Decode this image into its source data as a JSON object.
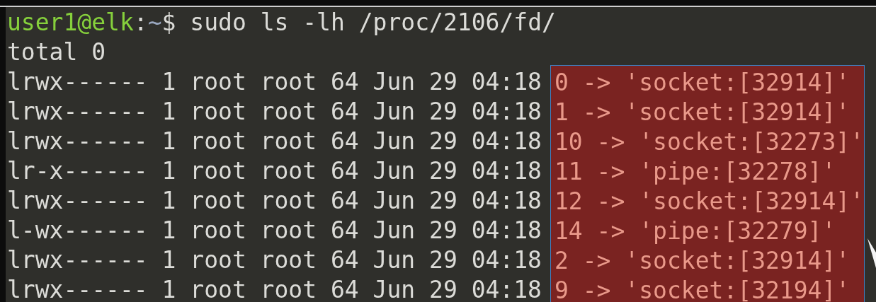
{
  "prompt": {
    "user_host": "user1@elk",
    "separator": ":",
    "path": "~",
    "symbol": "$",
    "command": "sudo ls -lh /proc/2106/fd/"
  },
  "output_lines": [
    "total 0"
  ],
  "entries": [
    {
      "listing": "lrwx------ 1 root root 64 Jun 29 04:18",
      "target": "0 -> 'socket:[32914]'"
    },
    {
      "listing": "lrwx------ 1 root root 64 Jun 29 04:18",
      "target": "1 -> 'socket:[32914]'"
    },
    {
      "listing": "lrwx------ 1 root root 64 Jun 29 04:18",
      "target": "10 -> 'socket:[32273]'"
    },
    {
      "listing": "lr-x------ 1 root root 64 Jun 29 04:18",
      "target": "11 -> 'pipe:[32278]'"
    },
    {
      "listing": "lrwx------ 1 root root 64 Jun 29 04:18",
      "target": "12 -> 'socket:[32914]'"
    },
    {
      "listing": "l-wx------ 1 root root 64 Jun 29 04:18",
      "target": "14 -> 'pipe:[32279]'"
    },
    {
      "listing": "lrwx------ 1 root root 64 Jun 29 04:18",
      "target": "2 -> 'socket:[32914]'"
    },
    {
      "listing": "lrwx------ 1 root root 64 Jun 29 04:18",
      "target": "9 -> 'socket:[32194]'"
    }
  ]
}
